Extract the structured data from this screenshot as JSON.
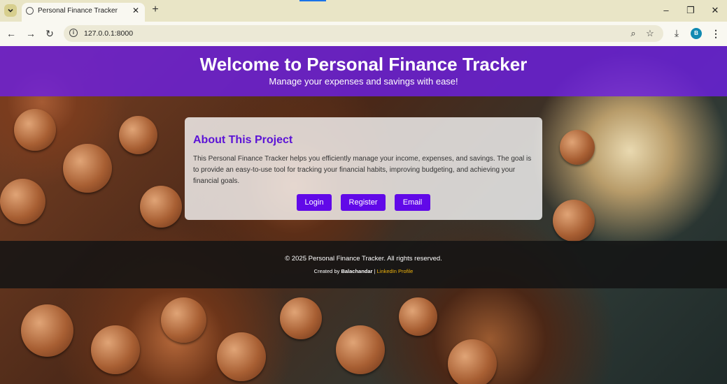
{
  "browser": {
    "tab_title": "Personal Finance Tracker",
    "url": "127.0.0.1:8000",
    "profile_initial": "B"
  },
  "header": {
    "title": "Welcome to Personal Finance Tracker",
    "subtitle": "Manage your expenses and savings with ease!"
  },
  "about": {
    "title": "About This Project",
    "text": "This Personal Finance Tracker helps you efficiently manage your income, expenses, and savings. The goal is to provide an easy-to-use tool for tracking your financial habits, improving budgeting, and achieving your financial goals.",
    "buttons": {
      "login": "Login",
      "register": "Register",
      "email": "Email"
    }
  },
  "footer": {
    "copyright": "© 2025 Personal Finance Tracker. All rights reserved.",
    "created_by_prefix": "Created by ",
    "author": "Balachandar",
    "separator": " | ",
    "linkedin_label": "LinkedIn Profile"
  },
  "colors": {
    "header_bg": "#6c20e2",
    "accent": "#5b12d6",
    "button": "#6109e8",
    "link": "#f1b50d"
  },
  "icons": [
    "tab-search-icon",
    "globe-icon",
    "close-icon",
    "plus-icon",
    "minimize-icon",
    "restore-icon",
    "back-icon",
    "forward-icon",
    "reload-icon",
    "info-icon",
    "zoom-icon",
    "star-icon",
    "download-icon",
    "more-icon"
  ]
}
